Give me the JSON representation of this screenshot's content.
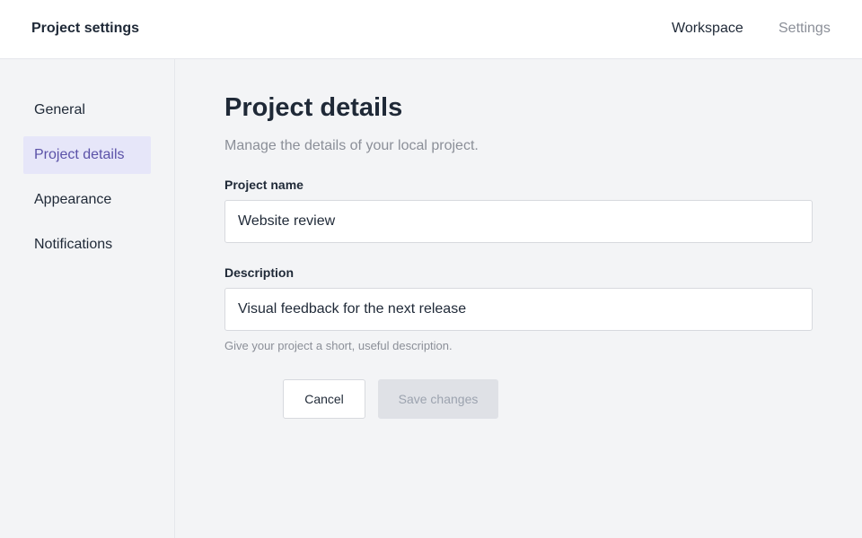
{
  "header": {
    "app_title": "Project settings",
    "nav": [
      {
        "label": "Workspace"
      },
      {
        "label": "Settings"
      }
    ]
  },
  "sidebar": {
    "active_index": 1,
    "items": [
      {
        "label": "General"
      },
      {
        "label": "Project details"
      },
      {
        "label": "Appearance"
      },
      {
        "label": "Notifications"
      }
    ]
  },
  "main": {
    "title": "Project details",
    "subtitle": "Manage the details of your local project.",
    "fields": {
      "project_name": {
        "label": "Project name",
        "value": "Website review"
      },
      "description": {
        "label": "Description",
        "value": "Visual feedback for the next release",
        "hint": "Give your project a short, useful description."
      }
    },
    "actions": {
      "cancel_label": "Cancel",
      "save_label": "Save changes",
      "save_enabled": false
    }
  },
  "colors": {
    "accent": "#5b52a8",
    "active_bg": "#e6e6f9",
    "muted_text": "#8b8f98",
    "disabled_bg": "#dfe1e6"
  }
}
